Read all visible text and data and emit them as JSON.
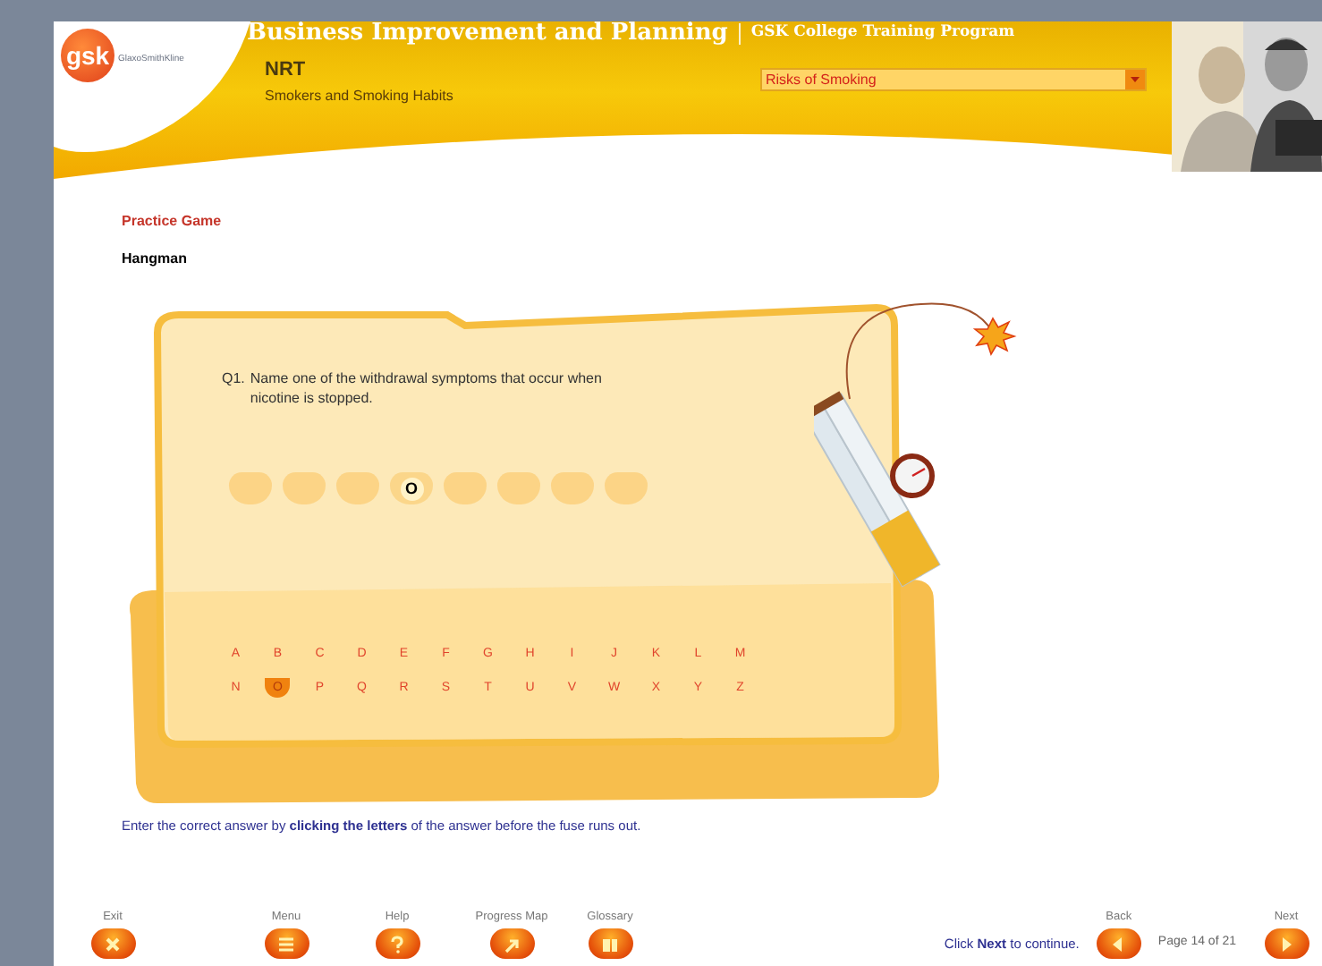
{
  "header": {
    "logo": "gsk",
    "logo_caption": "GlaxoSmithKline",
    "title": "Business Improvement and Planning",
    "program": "GSK College Training Program",
    "module": "NRT",
    "topic": "Smokers and Smoking Habits",
    "topic_select": {
      "value": "Risks of Smoking"
    }
  },
  "section_label": "Practice Game",
  "game_title": "Hangman",
  "question": {
    "number": "Q1.",
    "text": "Name one of the withdrawal symptoms that occur when nicotine is stopped."
  },
  "answer_slots": [
    {
      "revealed": false
    },
    {
      "revealed": false
    },
    {
      "revealed": false
    },
    {
      "revealed": true,
      "letter": "O"
    },
    {
      "revealed": false
    },
    {
      "revealed": false
    },
    {
      "revealed": false
    },
    {
      "revealed": false
    }
  ],
  "letters": [
    {
      "label": "A",
      "used": false
    },
    {
      "label": "B",
      "used": false
    },
    {
      "label": "C",
      "used": false
    },
    {
      "label": "D",
      "used": false
    },
    {
      "label": "E",
      "used": false
    },
    {
      "label": "F",
      "used": false
    },
    {
      "label": "G",
      "used": false
    },
    {
      "label": "H",
      "used": false
    },
    {
      "label": "I",
      "used": false
    },
    {
      "label": "J",
      "used": false
    },
    {
      "label": "K",
      "used": false
    },
    {
      "label": "L",
      "used": false
    },
    {
      "label": "M",
      "used": false
    },
    {
      "label": "N",
      "used": false
    },
    {
      "label": "O",
      "used": true
    },
    {
      "label": "P",
      "used": false
    },
    {
      "label": "Q",
      "used": false
    },
    {
      "label": "R",
      "used": false
    },
    {
      "label": "S",
      "used": false
    },
    {
      "label": "T",
      "used": false
    },
    {
      "label": "U",
      "used": false
    },
    {
      "label": "V",
      "used": false
    },
    {
      "label": "W",
      "used": false
    },
    {
      "label": "X",
      "used": false
    },
    {
      "label": "Y",
      "used": false
    },
    {
      "label": "Z",
      "used": false
    }
  ],
  "instruction": "Enter the correct answer by **clicking the letters** of the answer before the fuse runs out.",
  "nav_left": [
    {
      "kind": "exit",
      "label": "Exit"
    },
    {
      "kind": "menu",
      "label": "Menu"
    },
    {
      "kind": "help",
      "label": "Help"
    },
    {
      "kind": "progress",
      "label": "Progress Map"
    },
    {
      "kind": "glossary",
      "label": "Glossary"
    }
  ],
  "continue_hint": "Click **Next** to continue.",
  "back_button": {
    "kind": "back",
    "label": "Back"
  },
  "page_indicator": "Page 14 of 21",
  "next_button": {
    "kind": "next",
    "label": "Next"
  }
}
